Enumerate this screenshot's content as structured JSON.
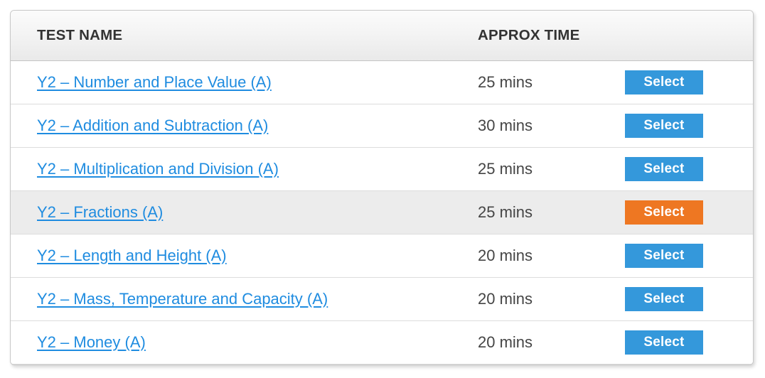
{
  "table": {
    "columns": [
      {
        "key": "name",
        "label": "TEST NAME"
      },
      {
        "key": "time",
        "label": "APPROX TIME"
      },
      {
        "key": "action",
        "label": ""
      }
    ],
    "rows": [
      {
        "name": "Y2 – Number and Place Value (A)",
        "time": "25 mins",
        "action_label": "Select",
        "highlighted": false,
        "action_variant": "primary"
      },
      {
        "name": "Y2 – Addition and Subtraction (A)",
        "time": "30 mins",
        "action_label": "Select",
        "highlighted": false,
        "action_variant": "primary"
      },
      {
        "name": "Y2 – Multiplication and Division (A)",
        "time": "25 mins",
        "action_label": "Select",
        "highlighted": false,
        "action_variant": "primary"
      },
      {
        "name": "Y2 – Fractions (A)",
        "time": "25 mins",
        "action_label": "Select",
        "highlighted": true,
        "action_variant": "accent"
      },
      {
        "name": "Y2 – Length and Height (A)",
        "time": "20 mins",
        "action_label": "Select",
        "highlighted": false,
        "action_variant": "primary"
      },
      {
        "name": "Y2 – Mass, Temperature and Capacity (A)",
        "time": "20 mins",
        "action_label": "Select",
        "highlighted": false,
        "action_variant": "primary"
      },
      {
        "name": "Y2 – Money (A)",
        "time": "20 mins",
        "action_label": "Select",
        "highlighted": false,
        "action_variant": "primary"
      }
    ]
  },
  "colors": {
    "link": "#1f8ce0",
    "button_primary": "#3498db",
    "button_accent": "#ee7722",
    "header_text": "#333333",
    "time_text": "#454545",
    "row_highlight": "#ececec",
    "row_divider": "#dddddd",
    "panel_border": "#c8c8c8"
  }
}
